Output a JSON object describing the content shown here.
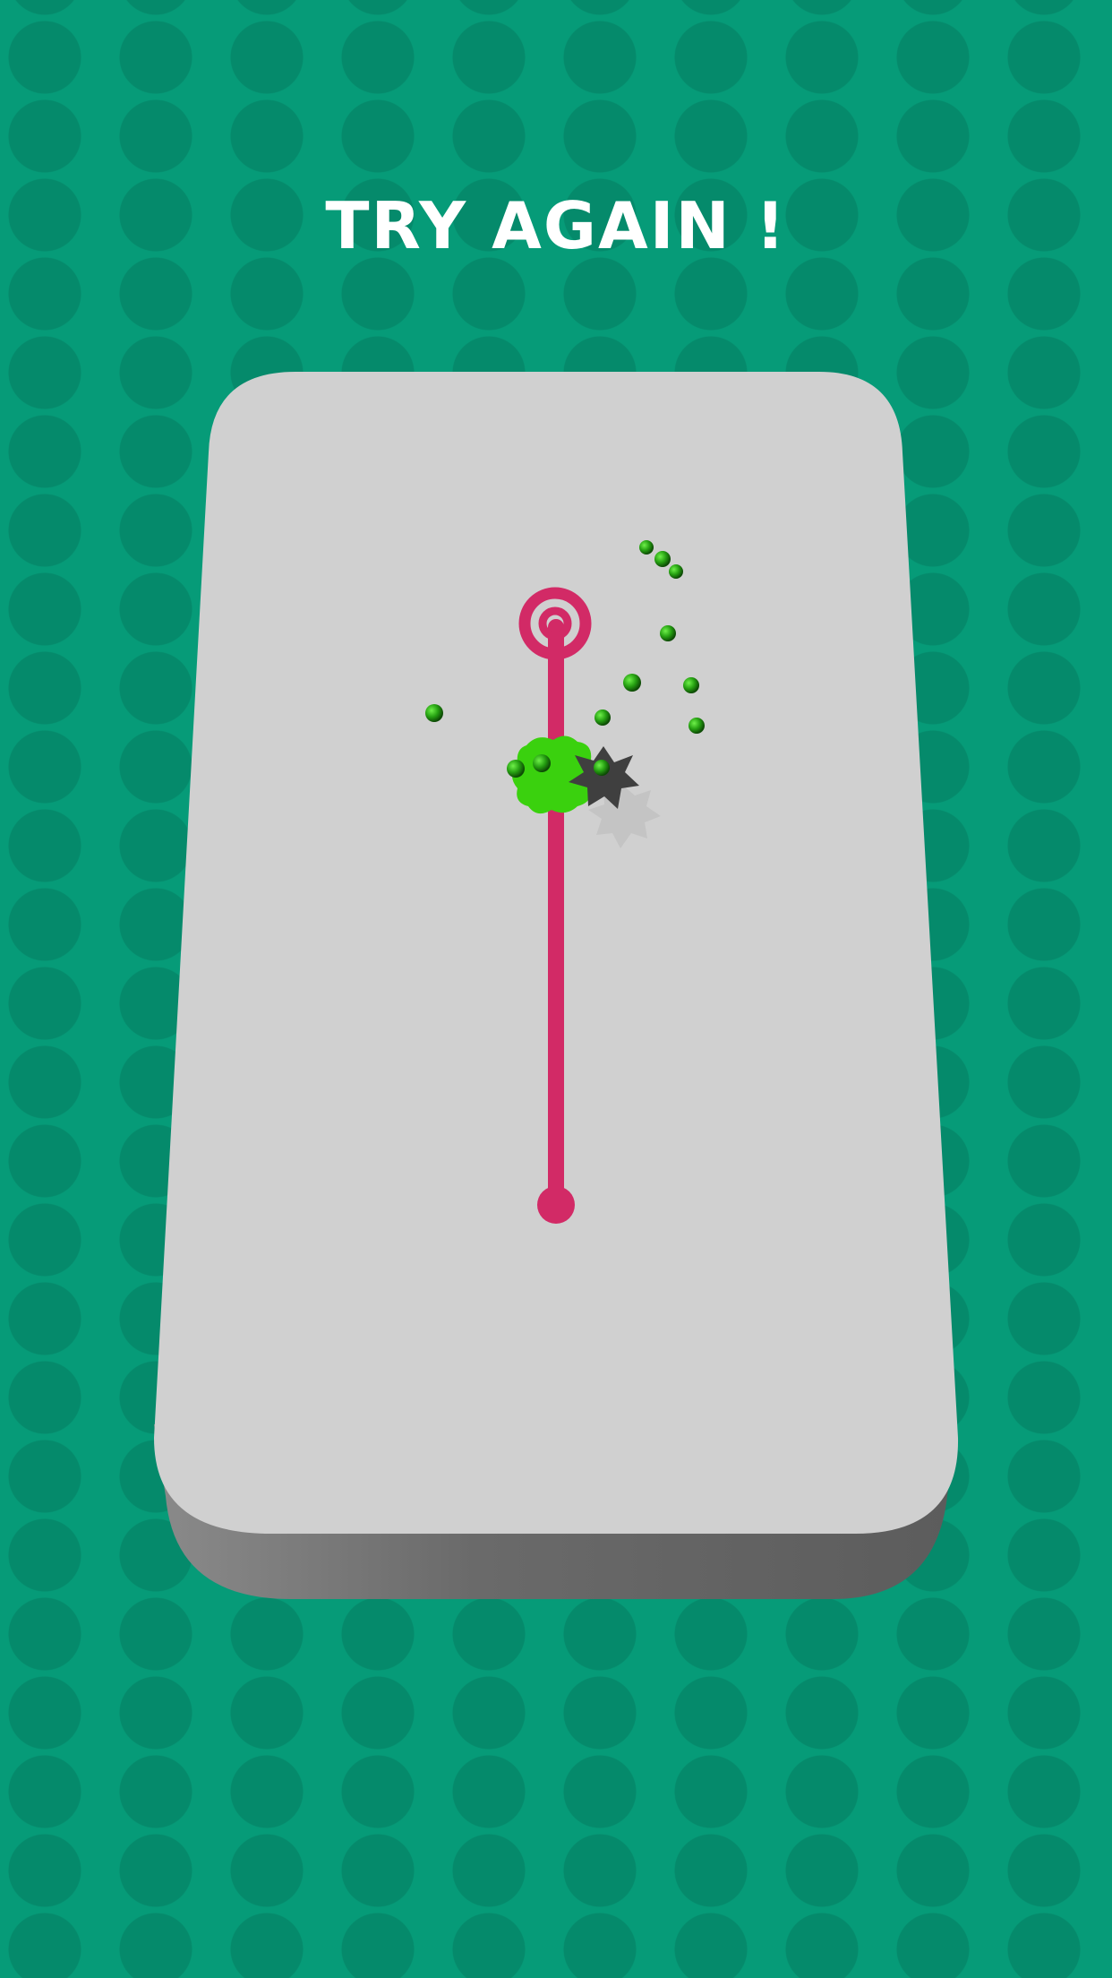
{
  "game": {
    "status_message": "TRY AGAIN !",
    "colors": {
      "background": "#069b78",
      "background_dots": "#058a6b",
      "board_top": "#d0d0d0",
      "board_side": "#6a6a6a",
      "track": "#d22a66",
      "paint_splat": "#3ad10e",
      "paint_balls": "#26a112",
      "spike_obstacle": "#3f3f3f",
      "spike_shadow": "#c4c4c4"
    },
    "icons": {
      "goal": "target-ring-icon",
      "start": "start-dot-icon",
      "obstacle": "spiked-ball-icon",
      "paint": "paint-splat-icon"
    }
  }
}
